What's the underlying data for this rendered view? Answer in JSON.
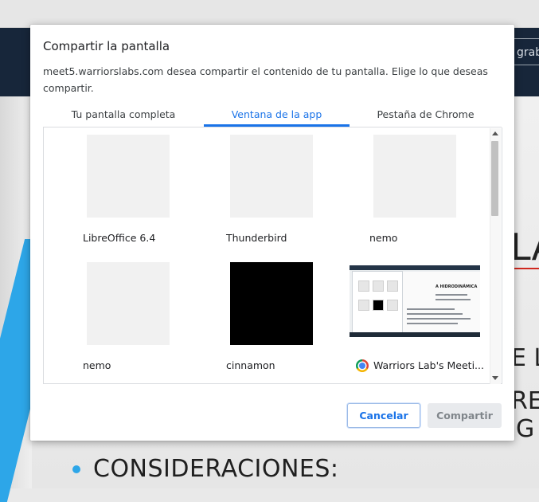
{
  "background": {
    "header_button": "graba",
    "slide_text_la": "LA",
    "slide_text_el": "E L",
    "slide_text_re": "RE",
    "slide_text_g": "G",
    "bullet_text": "CONSIDERACIONES:"
  },
  "dialog": {
    "title": "Compartir la pantalla",
    "description": "meet5.warriorslabs.com desea compartir el contenido de tu pantalla. Elige lo que deseas compartir.",
    "tabs": [
      {
        "label": "Tu pantalla completa",
        "selected": false
      },
      {
        "label": "Ventana de la app",
        "selected": true
      },
      {
        "label": "Pestaña de Chrome",
        "selected": false
      }
    ],
    "windows": [
      {
        "label": "LibreOffice 6.4"
      },
      {
        "label": "Thunderbird"
      },
      {
        "label": "nemo"
      },
      {
        "label": "nemo"
      },
      {
        "label": "cinnamon"
      },
      {
        "label": "Warriors Lab's Meeti..."
      }
    ],
    "thumbnail_preview": {
      "slide_title": "A HIDRODINÁMICA"
    },
    "buttons": {
      "cancel": "Cancelar",
      "share": "Compartir"
    }
  },
  "colors": {
    "accent": "#1a73e8",
    "header_bg": "#17263a",
    "slide_blue": "#2da6e8"
  }
}
